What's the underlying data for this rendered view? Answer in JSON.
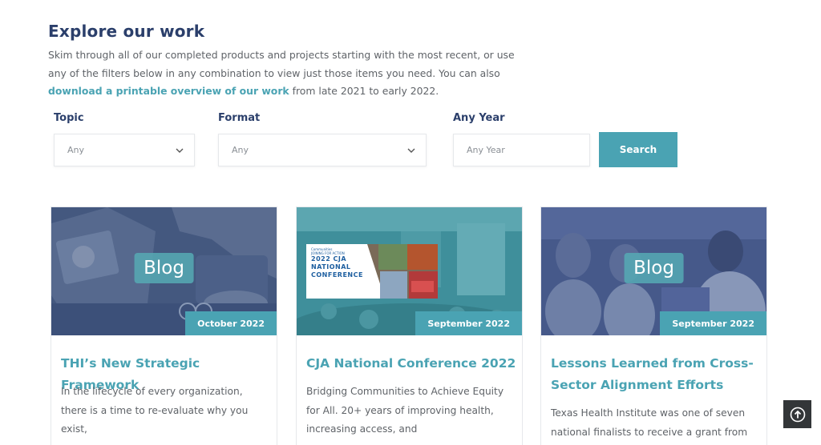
{
  "heading": "Explore our work",
  "intro": {
    "before": "Skim through all of our completed products and projects starting with the most recent, or use any of the filters below in any combination to view just those items you need. You can also ",
    "link": "download a printable overview of our work",
    "after": " from late 2021 to early 2022."
  },
  "filters": {
    "topic_label": "Topic",
    "topic_value": "Any",
    "format_label": "Format",
    "format_value": "Any",
    "year_label": "Any Year",
    "year_placeholder": "Any Year",
    "search_label": "Search"
  },
  "cards": [
    {
      "badge": "Blog",
      "date": "October 2022",
      "title": "THI’s New Strategic Framework",
      "desc": "In the lifecycle of every organization, there is a time to re-evaluate why you exist,"
    },
    {
      "date": "September 2022",
      "title": "CJA National Conference 2022",
      "desc": "Bridging Communities to Achieve Equity for All. 20+ years of improving health, increasing access, and",
      "flyer": {
        "org_line1": "Communities",
        "org_line2": "JOINING FOR ACTION",
        "title": "2022 CJA NATIONAL CONFERENCE"
      }
    },
    {
      "badge": "Blog",
      "date": "September 2022",
      "title": "Lessons Learned from Cross-Sector Alignment Efforts",
      "desc": "Texas Health Institute was one of seven national finalists to receive a grant from"
    }
  ],
  "icons": {
    "select_chevron": "chevron-down-icon",
    "back_to_top": "arrow-up-circle-icon"
  },
  "colors": {
    "heading": "#2b3f6b",
    "accent": "#4aa3b3",
    "overlay_navy": "#3e5383",
    "overlay_teal": "#3f8f9b"
  }
}
